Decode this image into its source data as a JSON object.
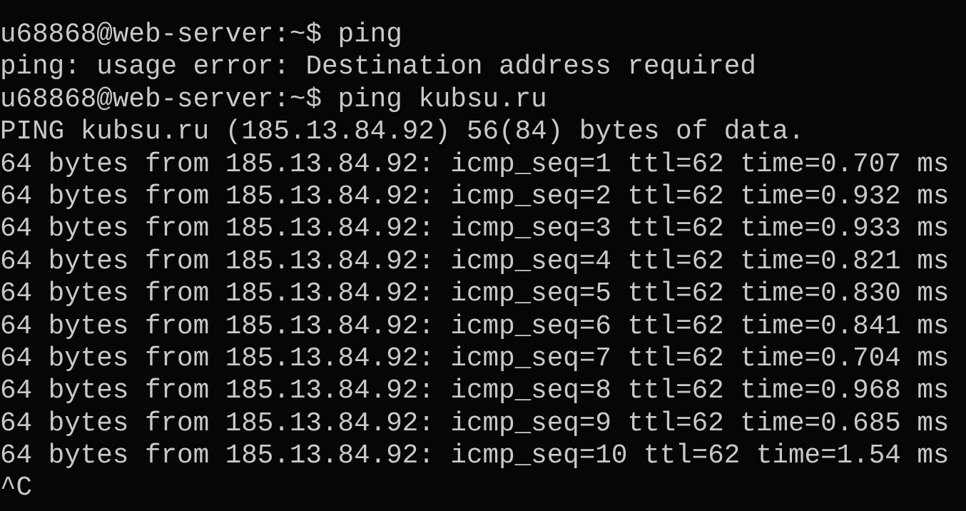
{
  "terminal": {
    "lines": [
      "u68868@web-server:~$ ping",
      "ping: usage error: Destination address required",
      "u68868@web-server:~$ ping kubsu.ru",
      "PING kubsu.ru (185.13.84.92) 56(84) bytes of data.",
      "64 bytes from 185.13.84.92: icmp_seq=1 ttl=62 time=0.707 ms",
      "64 bytes from 185.13.84.92: icmp_seq=2 ttl=62 time=0.932 ms",
      "64 bytes from 185.13.84.92: icmp_seq=3 ttl=62 time=0.933 ms",
      "64 bytes from 185.13.84.92: icmp_seq=4 ttl=62 time=0.821 ms",
      "64 bytes from 185.13.84.92: icmp_seq=5 ttl=62 time=0.830 ms",
      "64 bytes from 185.13.84.92: icmp_seq=6 ttl=62 time=0.841 ms",
      "64 bytes from 185.13.84.92: icmp_seq=7 ttl=62 time=0.704 ms",
      "64 bytes from 185.13.84.92: icmp_seq=8 ttl=62 time=0.968 ms",
      "64 bytes from 185.13.84.92: icmp_seq=9 ttl=62 time=0.685 ms",
      "64 bytes from 185.13.84.92: icmp_seq=10 ttl=62 time=1.54 ms",
      "^C"
    ],
    "colors": {
      "background": "#060606",
      "text": "#c9c9c9"
    }
  }
}
